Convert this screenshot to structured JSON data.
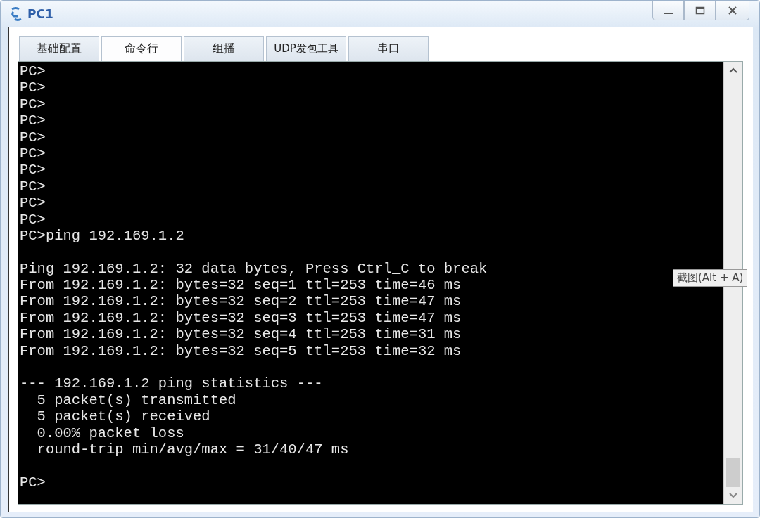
{
  "window": {
    "title": "PC1"
  },
  "tabs": [
    {
      "label": "基础配置",
      "selected": false
    },
    {
      "label": "命令行",
      "selected": true
    },
    {
      "label": "组播",
      "selected": false
    },
    {
      "label": "UDP发包工具",
      "selected": false
    },
    {
      "label": "串口",
      "selected": false
    }
  ],
  "terminal": {
    "blocks": [
      {
        "lines": [
          "PC>",
          "PC>",
          "PC>",
          "PC>",
          "PC>",
          "PC>",
          "PC>",
          "PC>",
          "PC>",
          "PC>",
          "PC>ping 192.169.1.2"
        ]
      },
      {
        "lines": [
          "Ping 192.169.1.2: 32 data bytes, Press Ctrl_C to break",
          "From 192.169.1.2: bytes=32 seq=1 ttl=253 time=46 ms",
          "From 192.169.1.2: bytes=32 seq=2 ttl=253 time=47 ms",
          "From 192.169.1.2: bytes=32 seq=3 ttl=253 time=47 ms",
          "From 192.169.1.2: bytes=32 seq=4 ttl=253 time=31 ms",
          "From 192.169.1.2: bytes=32 seq=5 ttl=253 time=32 ms"
        ]
      },
      {
        "lines": [
          "--- 192.169.1.2 ping statistics ---",
          "  5 packet(s) transmitted",
          "  5 packet(s) received",
          "  0.00% packet loss",
          "  round-trip min/avg/max = 31/40/47 ms"
        ]
      },
      {
        "lines": [
          "PC>"
        ]
      }
    ]
  },
  "tooltip": {
    "text": "截图(Alt + A)"
  }
}
